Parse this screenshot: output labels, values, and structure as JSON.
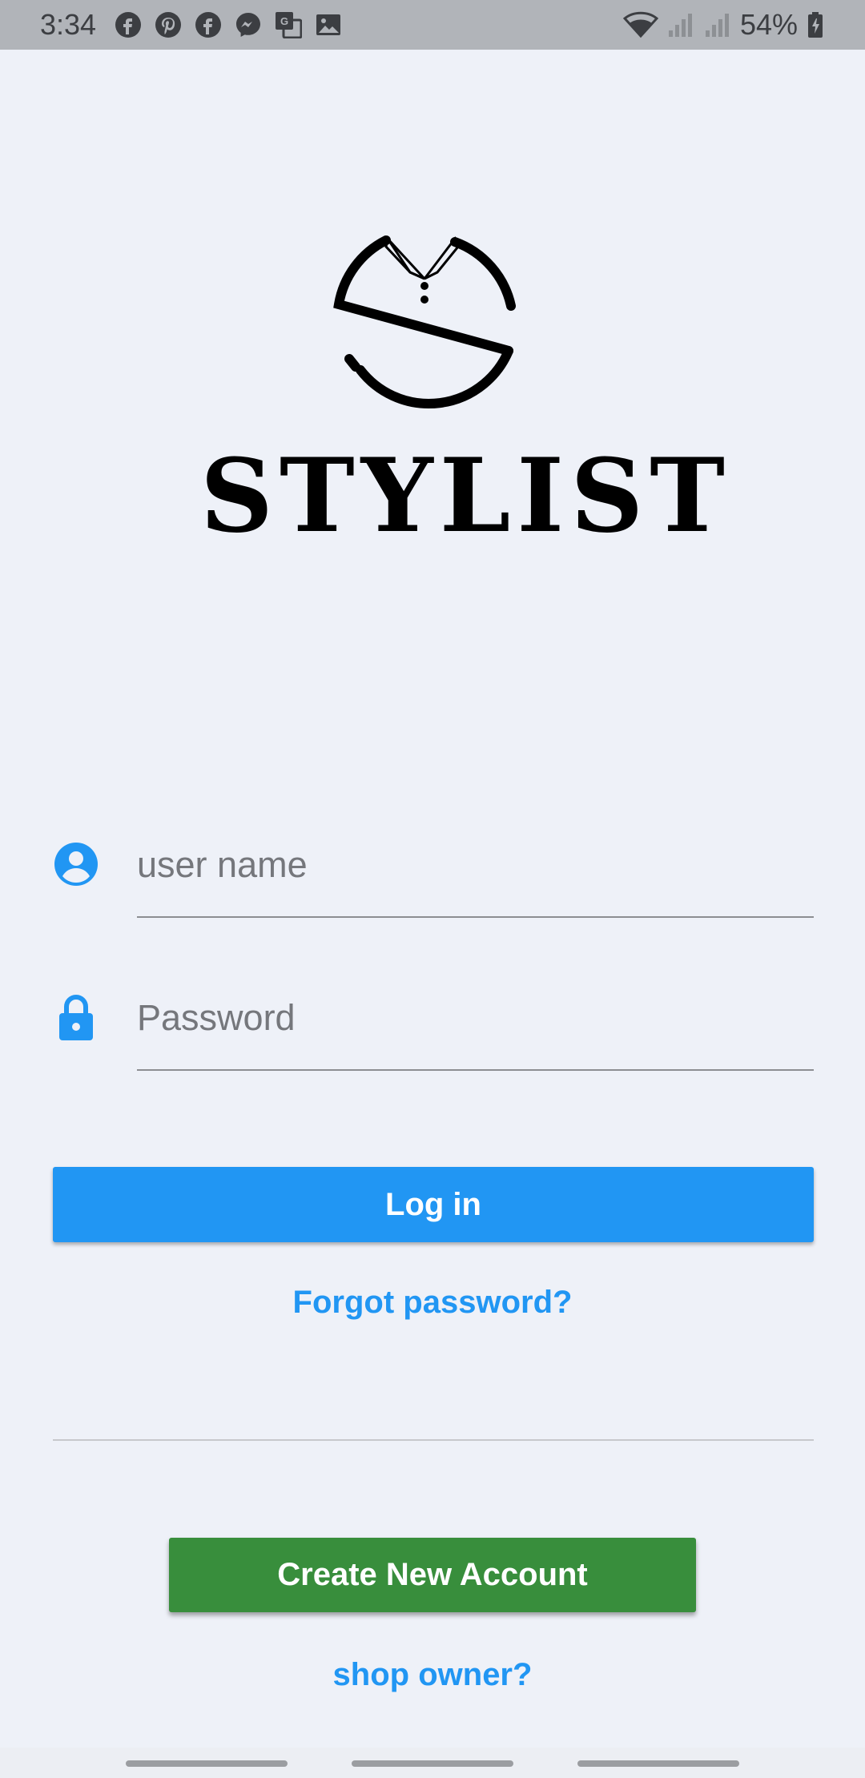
{
  "status_bar": {
    "time": "3:34",
    "battery": "54%",
    "left_icons": [
      "facebook-icon",
      "pinterest-icon",
      "facebook-icon",
      "messenger-icon",
      "translate-icon",
      "gallery-icon"
    ],
    "right_icons": [
      "wifi-icon",
      "signal-icon",
      "signal-icon",
      "battery-icon"
    ]
  },
  "logo": {
    "brand": "STYLIST"
  },
  "form": {
    "username_placeholder": "user name",
    "password_placeholder": "Password",
    "login_label": "Log in",
    "forgot_label": "Forgot password?"
  },
  "register": {
    "create_label": "Create New Account",
    "shop_owner_label": "shop owner?"
  },
  "colors": {
    "primary": "#2196f3",
    "create_button": "#388e3c",
    "background": "#eef1f8",
    "status_bar": "#b1b4b9"
  }
}
